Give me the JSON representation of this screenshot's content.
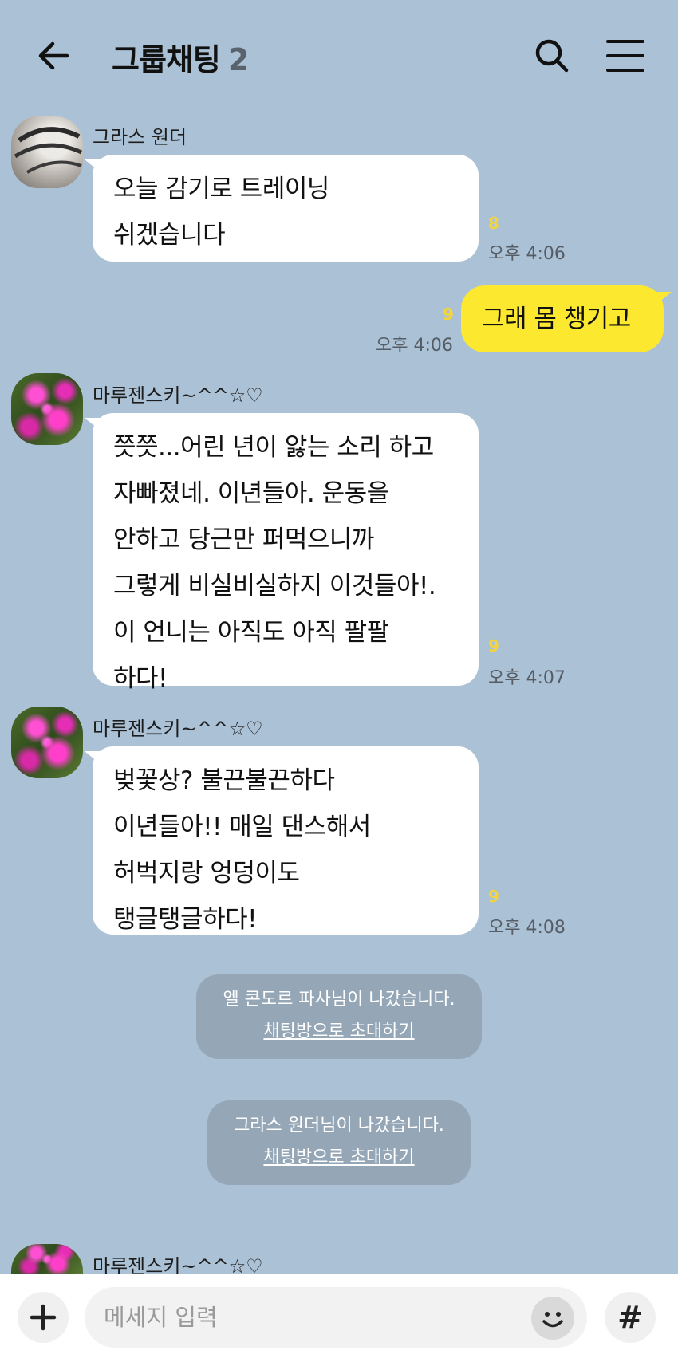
{
  "header": {
    "title": "그룹채팅",
    "member_count": "2"
  },
  "messages": [
    {
      "sender": "그라스 원더",
      "text": "오늘 감기로 트레이닝\n쉬겠습니다",
      "unread": "8",
      "time": "오후 4:06"
    },
    {
      "text": "그래 몸 챙기고",
      "unread": "9",
      "time": "오후 4:06"
    },
    {
      "sender": "마루젠스키~^^☆♡",
      "text": "쯧쯧...어린 년이 앓는 소리 하고\n자빠졌네. 이년들아. 운동을\n안하고 당근만 퍼먹으니까\n그렇게 비실비실하지 이것들아!.\n이 언니는 아직도 아직 팔팔\n하다!",
      "unread": "9",
      "time": "오후 4:07"
    },
    {
      "sender": "마루젠스키~^^☆♡",
      "text": "벚꽃상? 불끈불끈하다\n이년들아!! 매일 댄스해서\n허벅지랑 엉덩이도\n탱글탱글하다!",
      "unread": "9",
      "time": "오후 4:08"
    },
    {
      "sender": "마루젠스키~^^☆♡"
    }
  ],
  "notices": [
    {
      "text": "엘 콘도르 파사님이 나갔습니다.",
      "link": "채팅방으로 초대하기"
    },
    {
      "text": "그라스 원더님이 나갔습니다.",
      "link": "채팅방으로 초대하기"
    }
  ],
  "input": {
    "placeholder": "메세지 입력",
    "hash": "#"
  },
  "colors": {
    "background": "#abc1d6",
    "my_bubble": "#fde830",
    "their_bubble": "#ffffff",
    "unread": "#f3d43a",
    "notice": "#95a7b7"
  },
  "icons": [
    "back-arrow-icon",
    "search-icon",
    "hamburger-menu-icon",
    "plus-icon",
    "emoji-icon"
  ]
}
